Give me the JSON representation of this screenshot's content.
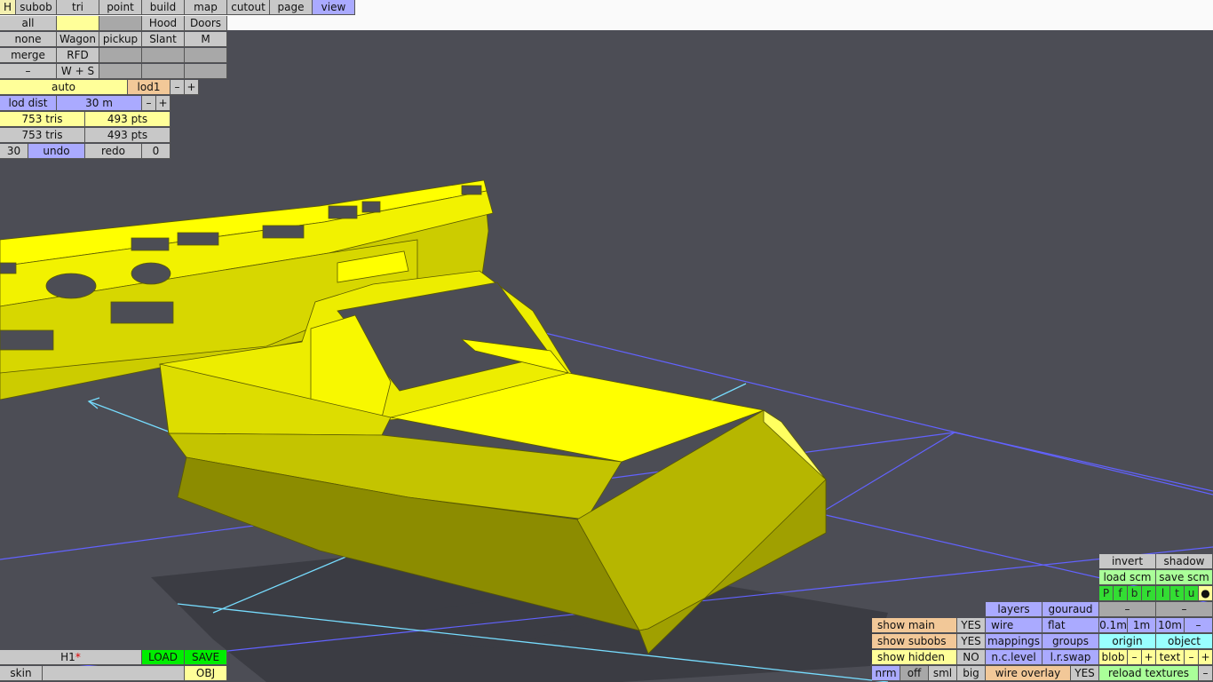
{
  "toolbar": {
    "tabs": [
      "H",
      "subob",
      "tri",
      "point",
      "build",
      "map",
      "cutout",
      "page",
      "view"
    ],
    "active_tab": "view"
  },
  "select_panel": {
    "all": "all",
    "none": "none",
    "merge": "merge",
    "minus": "–",
    "wagon": "Wagon",
    "rfd": "RFD",
    "ws": "W + S",
    "pickup": "pickup",
    "hood": "Hood",
    "slant": "Slant",
    "doors": "Doors",
    "m": "M"
  },
  "lod_panel": {
    "auto": "auto",
    "lod": "lod1",
    "minus": "–",
    "plus": "+",
    "lod_dist_label": "lod dist",
    "lod_dist_value": "30 m",
    "tris_1": "753 tris",
    "pts_1": "493 pts",
    "tris_2": "753 tris",
    "pts_2": "493 pts",
    "undo_count": "30",
    "undo": "undo",
    "redo": "redo",
    "redo_count": "0"
  },
  "file_panel": {
    "name": "H1",
    "modified_mark": "*",
    "load": "LOAD",
    "save": "SAVE",
    "skin": "skin",
    "obj": "OBJ"
  },
  "display_panel": {
    "show_main": "show main",
    "show_main_val": "YES",
    "show_subobs": "show subobs",
    "show_subobs_val": "YES",
    "show_hidden": "show hidden",
    "show_hidden_val": "NO",
    "nrm": "nrm",
    "off": "off",
    "sml": "sml",
    "big": "big",
    "layers": "layers",
    "gouraud": "gouraud",
    "wire": "wire",
    "flat": "flat",
    "mappings": "mappings",
    "groups": "groups",
    "nc_level": "n.c.level",
    "lr_swap": "l.r.swap",
    "wire_overlay": "wire overlay",
    "wire_overlay_val": "YES"
  },
  "tools_panel": {
    "invert": "invert",
    "shadow": "shadow",
    "load_scm": "load scm",
    "save_scm": "save scm",
    "view_letters": [
      "P",
      "f",
      "b",
      "r",
      "l",
      "t",
      "u",
      "●"
    ],
    "dash": "–",
    "grid_01": "0.1m",
    "grid_1": "1m",
    "grid_10": "10m",
    "origin": "origin",
    "object": "object",
    "blob": "blob",
    "text": "text",
    "plus": "+",
    "reload_textures": "reload textures"
  },
  "colors": {
    "sky": "#fafafa",
    "floor": "#4c4d55",
    "model": "#ffff00",
    "grid_line": "#6666ff",
    "axis_line": "#66ffff",
    "shadow": "#3c3d43"
  }
}
